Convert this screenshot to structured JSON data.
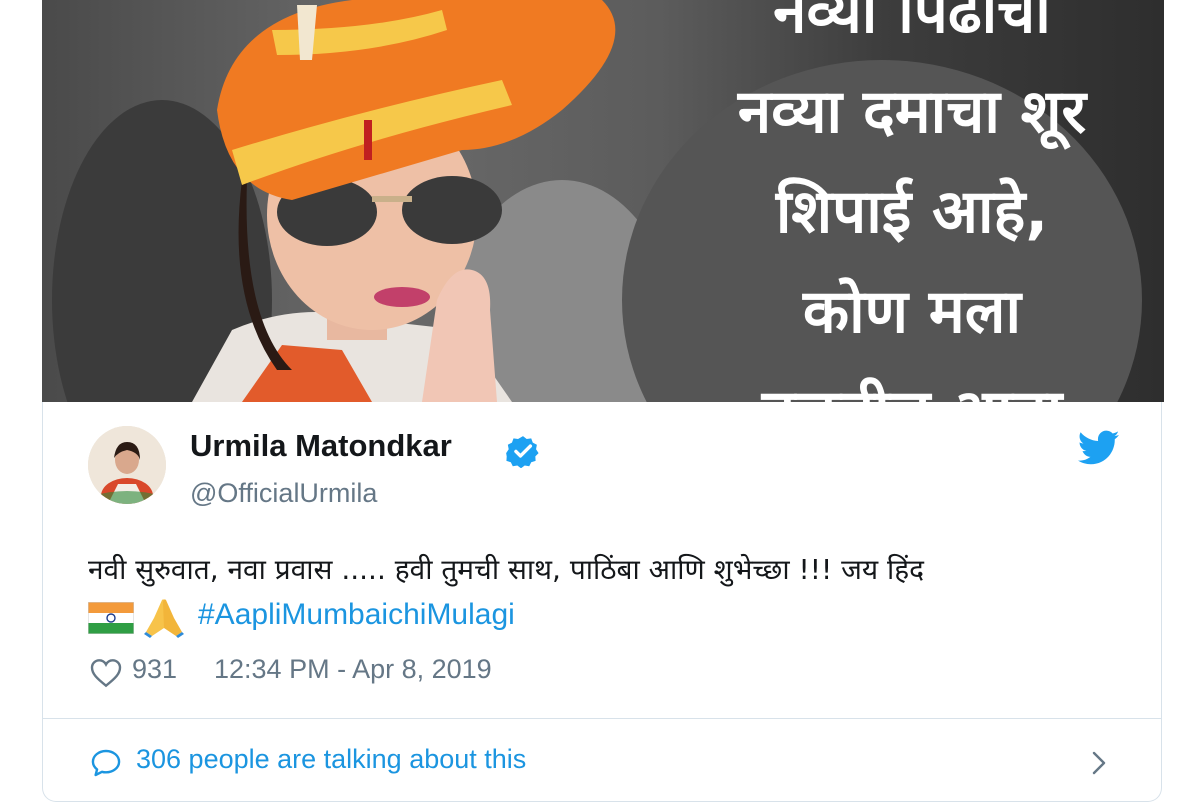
{
  "photo": {
    "overlay_lines": [
      "नव्या पिढीचा",
      "नव्या दमाचा शूर",
      "शिपाई आहे,",
      "कोण मला",
      "वळवील आता"
    ]
  },
  "tweet": {
    "author_name": "Urmila Matondkar",
    "author_handle": "@OfficialUrmila",
    "text": "नवी सुरुवात, नवा प्रवास ..... हवी तुमची साथ, पाठिंबा आणि शुभेच्छा !!! जय हिंद",
    "emojis": [
      "india-flag",
      "folded-hands"
    ],
    "hashtag": "#AapliMumbaichiMulagi",
    "likes": "931",
    "timestamp": "12:34 PM - Apr 8, 2019",
    "talking": "306 people are talking about this"
  },
  "colors": {
    "link_blue": "#1b95e0",
    "secondary_text": "#657786",
    "primary_text": "#14171a",
    "verified_blue": "#1da1f2",
    "turban_orange": "#f07a22"
  },
  "icons": [
    "verified-badge-icon",
    "twitter-bird-icon",
    "heart-icon",
    "comment-bubble-icon",
    "chevron-right-icon"
  ]
}
